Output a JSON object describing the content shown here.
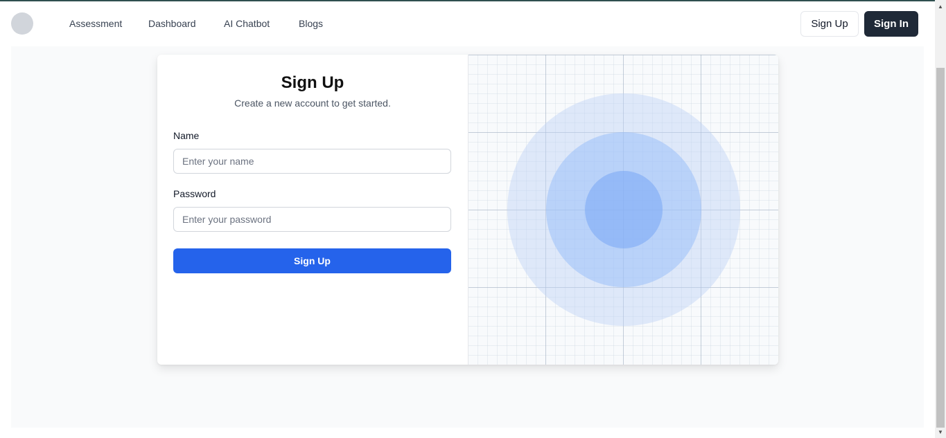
{
  "header": {
    "nav": [
      {
        "label": "Assessment"
      },
      {
        "label": "Dashboard"
      },
      {
        "label": "AI Chatbot"
      },
      {
        "label": "Blogs"
      }
    ],
    "signup_label": "Sign Up",
    "signin_label": "Sign In"
  },
  "form": {
    "title": "Sign Up",
    "subtitle": "Create a new account to get started.",
    "name_label": "Name",
    "name_placeholder": "Enter your name",
    "name_value": "",
    "password_label": "Password",
    "password_placeholder": "Enter your password",
    "password_value": "",
    "submit_label": "Sign Up"
  },
  "colors": {
    "primary": "#2563eb",
    "dark_button": "#1f2937",
    "page_bg": "#f9fafb"
  },
  "scrollbar": {
    "up_icon": "triangle-up",
    "down_icon": "triangle-down"
  }
}
